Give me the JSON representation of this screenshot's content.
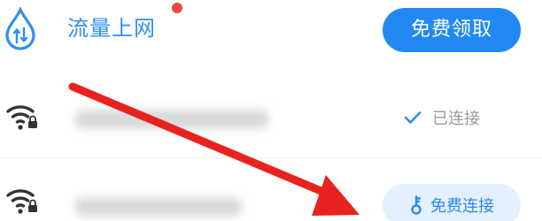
{
  "top_row": {
    "title": "流量上网",
    "claim_button_label": "免费领取",
    "icon": "water-drop-data-icon",
    "notification_dot_color": "#f0473e"
  },
  "networks": [
    {
      "ssid": "",
      "status_label": "已连接",
      "status_icon": "check-icon"
    },
    {
      "ssid": "",
      "action_label": "免费连接",
      "action_icon": "key-icon"
    }
  ],
  "colors": {
    "accent": "#2289f2",
    "title_blue": "#2f8ff0",
    "annotation_arrow": "#e8231f",
    "muted_text": "#9b9b9b",
    "soft_button_bg": "#e3f0fd"
  }
}
